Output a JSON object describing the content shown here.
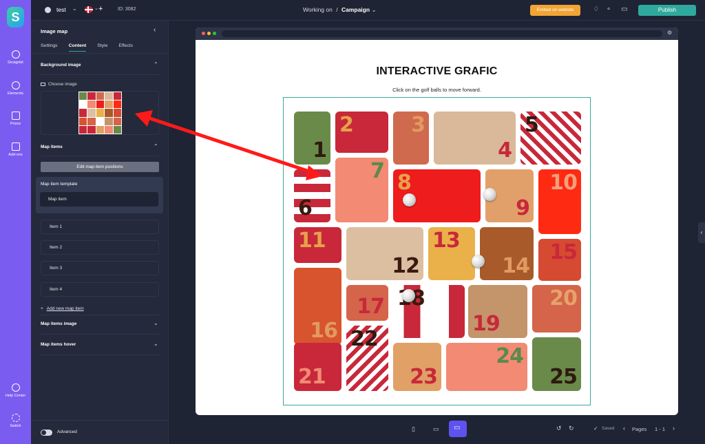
{
  "app": {
    "logo": "S"
  },
  "rail": [
    {
      "label": "Designkit",
      "icon": "palette-icon"
    },
    {
      "label": "Elements",
      "icon": "plus-circle-icon"
    },
    {
      "label": "Prizes",
      "icon": "gift-icon"
    },
    {
      "label": "Add-ons",
      "icon": "grid-plus-icon"
    },
    {
      "label": "Help Center",
      "icon": "question-icon"
    },
    {
      "label": "Switch",
      "icon": "switch-icon"
    }
  ],
  "topbar": {
    "project_name": "test",
    "id_text": "ID: 3082",
    "working_on_label": "Working on",
    "separator": "/",
    "campaign_label": "Campaign",
    "embed_label": "Embed on website",
    "publish_label": "Publish"
  },
  "panel": {
    "title": "Image map",
    "tabs": [
      "Settings",
      "Content",
      "Style",
      "Effects"
    ],
    "active_tab": "Content",
    "background_image_heading": "Background image",
    "choose_image_label": "Choose image",
    "map_items_heading": "Map items",
    "edit_positions_label": "Edit map item positions",
    "template_title": "Map item template",
    "template_item_label": "Map item",
    "items": [
      "Item 1",
      "Item 2",
      "Item 3",
      "Item 4"
    ],
    "add_item_label": "Add new map item",
    "map_items_image_heading": "Map items image",
    "map_items_hover_heading": "Map items hover",
    "advanced_label": "Advanced"
  },
  "canvas": {
    "title": "INTERACTIVE GRAFIC",
    "subtitle": "Click on the golf balls to move forward.",
    "tiles": [
      "1",
      "2",
      "3",
      "4",
      "5",
      "6",
      "7",
      "8",
      "9",
      "10",
      "11",
      "12",
      "13",
      "14",
      "15",
      "16",
      "17",
      "18",
      "19",
      "20",
      "21",
      "22",
      "23",
      "24",
      "25"
    ]
  },
  "bottom": {
    "saved_label": "Saved",
    "pages_label": "Pages",
    "page_range": "1 - 1"
  },
  "colors": {
    "accent": "#7b5cf0",
    "publish": "#2fa99d",
    "embed": "#f2a534",
    "arrow": "#ff1a1a"
  }
}
